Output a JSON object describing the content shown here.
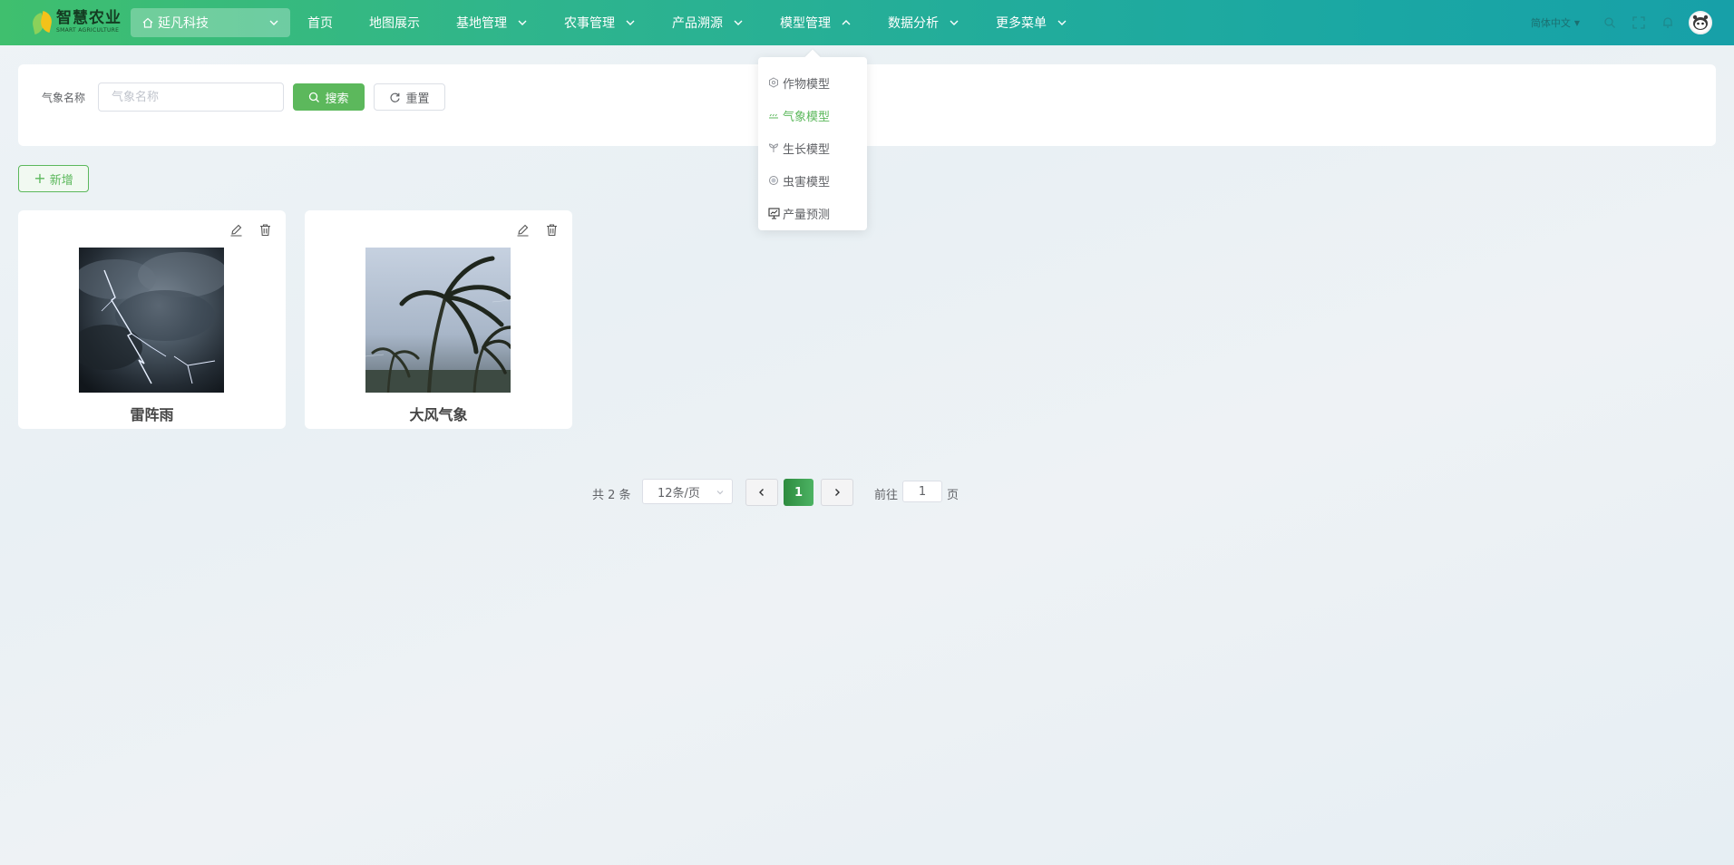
{
  "brand": {
    "name_cn": "智慧农业",
    "name_en": "SMART AGRICULTURE"
  },
  "org_select": {
    "value": "延凡科技"
  },
  "nav": {
    "items": [
      {
        "label": "首页",
        "has_dropdown": false
      },
      {
        "label": "地图展示",
        "has_dropdown": false
      },
      {
        "label": "基地管理",
        "has_dropdown": true
      },
      {
        "label": "农事管理",
        "has_dropdown": true
      },
      {
        "label": "产品溯源",
        "has_dropdown": true
      },
      {
        "label": "模型管理",
        "has_dropdown": true,
        "open": true
      },
      {
        "label": "数据分析",
        "has_dropdown": true
      },
      {
        "label": "更多菜单",
        "has_dropdown": true
      }
    ]
  },
  "header_tools": {
    "language": "简体中文"
  },
  "model_menu": {
    "items": [
      {
        "label": "作物模型",
        "icon": "crop-icon",
        "active": false
      },
      {
        "label": "气象模型",
        "icon": "weather-icon",
        "active": true
      },
      {
        "label": "生长模型",
        "icon": "growth-icon",
        "active": false
      },
      {
        "label": "虫害模型",
        "icon": "pest-icon",
        "active": false
      },
      {
        "label": "产量预测",
        "icon": "yield-chart-icon",
        "active": false
      }
    ]
  },
  "search": {
    "label": "气象名称",
    "placeholder": "气象名称",
    "value": "",
    "search_button": "搜索",
    "reset_button": "重置"
  },
  "add_button": "新增",
  "cards": [
    {
      "title": "雷阵雨",
      "image": "thunderstorm-lightning-photo"
    },
    {
      "title": "大风气象",
      "image": "strong-wind-palm-trees-photo"
    }
  ],
  "pagination": {
    "total_text": "共 2 条",
    "page_size": "12条/页",
    "current_page": "1",
    "goto_label": "前往",
    "goto_value": "1",
    "page_suffix": "页"
  },
  "colors": {
    "accent": "#5cb85c",
    "nav_gradient_start": "#3fbf6e",
    "nav_gradient_end": "#17a0a8"
  }
}
